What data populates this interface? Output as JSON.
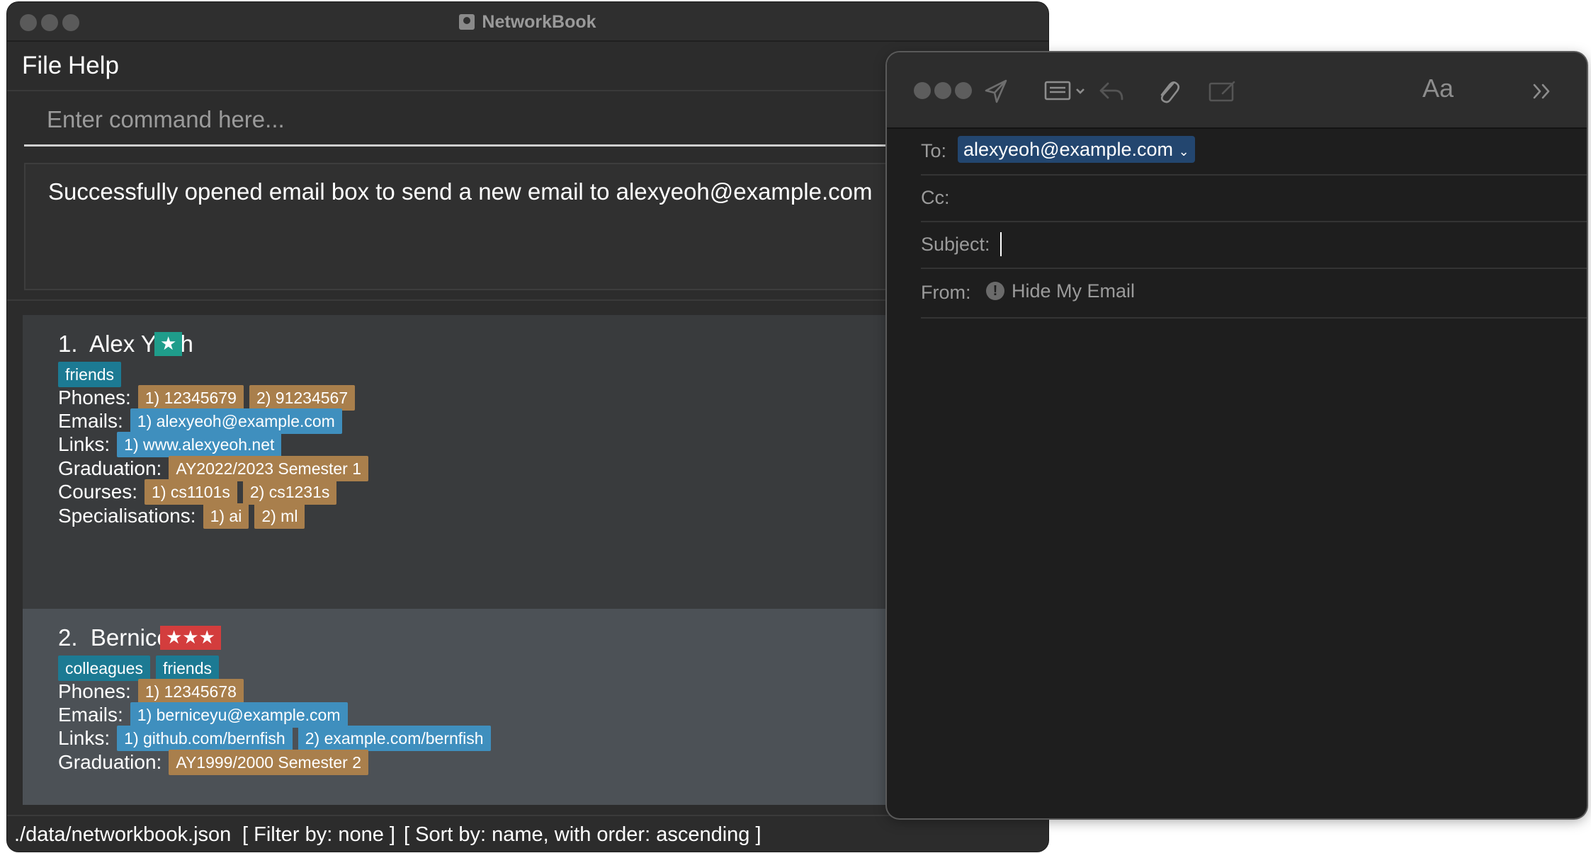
{
  "networkbook": {
    "title": "NetworkBook",
    "menu": [
      "File",
      "Help"
    ],
    "command_placeholder": "Enter command here...",
    "result": "Successfully opened email box to send a new email to alexyeoh@example.com",
    "contacts": [
      {
        "index": "1.",
        "name": "Alex Yeoh",
        "stars": "★",
        "star_color": "#1f9d8b",
        "tags": [
          "friends"
        ],
        "phones_label": "Phones:",
        "phones": [
          "1) 12345679",
          "2) 91234567"
        ],
        "emails_label": "Emails:",
        "emails": [
          "1) alexyeoh@example.com"
        ],
        "links_label": "Links:",
        "links": [
          "1) www.alexyeoh.net"
        ],
        "graduation_label": "Graduation:",
        "graduation": "AY2022/2023 Semester 1",
        "courses_label": "Courses:",
        "courses": [
          "1) cs1101s",
          "2) cs1231s"
        ],
        "specialisations_label": "Specialisations:",
        "specialisations": [
          "1) ai",
          "2) ml"
        ]
      },
      {
        "index": "2.",
        "name": "Bernice Yu",
        "stars": "★★★",
        "star_color": "#d33d3d",
        "tags": [
          "colleagues",
          "friends"
        ],
        "phones_label": "Phones:",
        "phones": [
          "1) 12345678"
        ],
        "emails_label": "Emails:",
        "emails": [
          "1) berniceyu@example.com"
        ],
        "links_label": "Links:",
        "links": [
          "1) github.com/bernfish",
          "2) example.com/bernfish"
        ],
        "graduation_label": "Graduation:",
        "graduation": "AY1999/2000 Semester 2"
      }
    ],
    "status": {
      "file": "./data/networkbook.json",
      "filter": "[ Filter by: none ]",
      "sort": "[ Sort by: name, with order: ascending ]"
    }
  },
  "mail": {
    "to_label": "To:",
    "to_value": "alexyeoh@example.com",
    "cc_label": "Cc:",
    "subject_label": "Subject:",
    "from_label": "From:",
    "from_value": "Hide My Email",
    "font_button": "Aa",
    "toolbar_icons": [
      "send-icon",
      "header-fields-icon",
      "reply-icon",
      "paperclip-icon",
      "compose-icon",
      "more-chevrons-icon"
    ]
  }
}
